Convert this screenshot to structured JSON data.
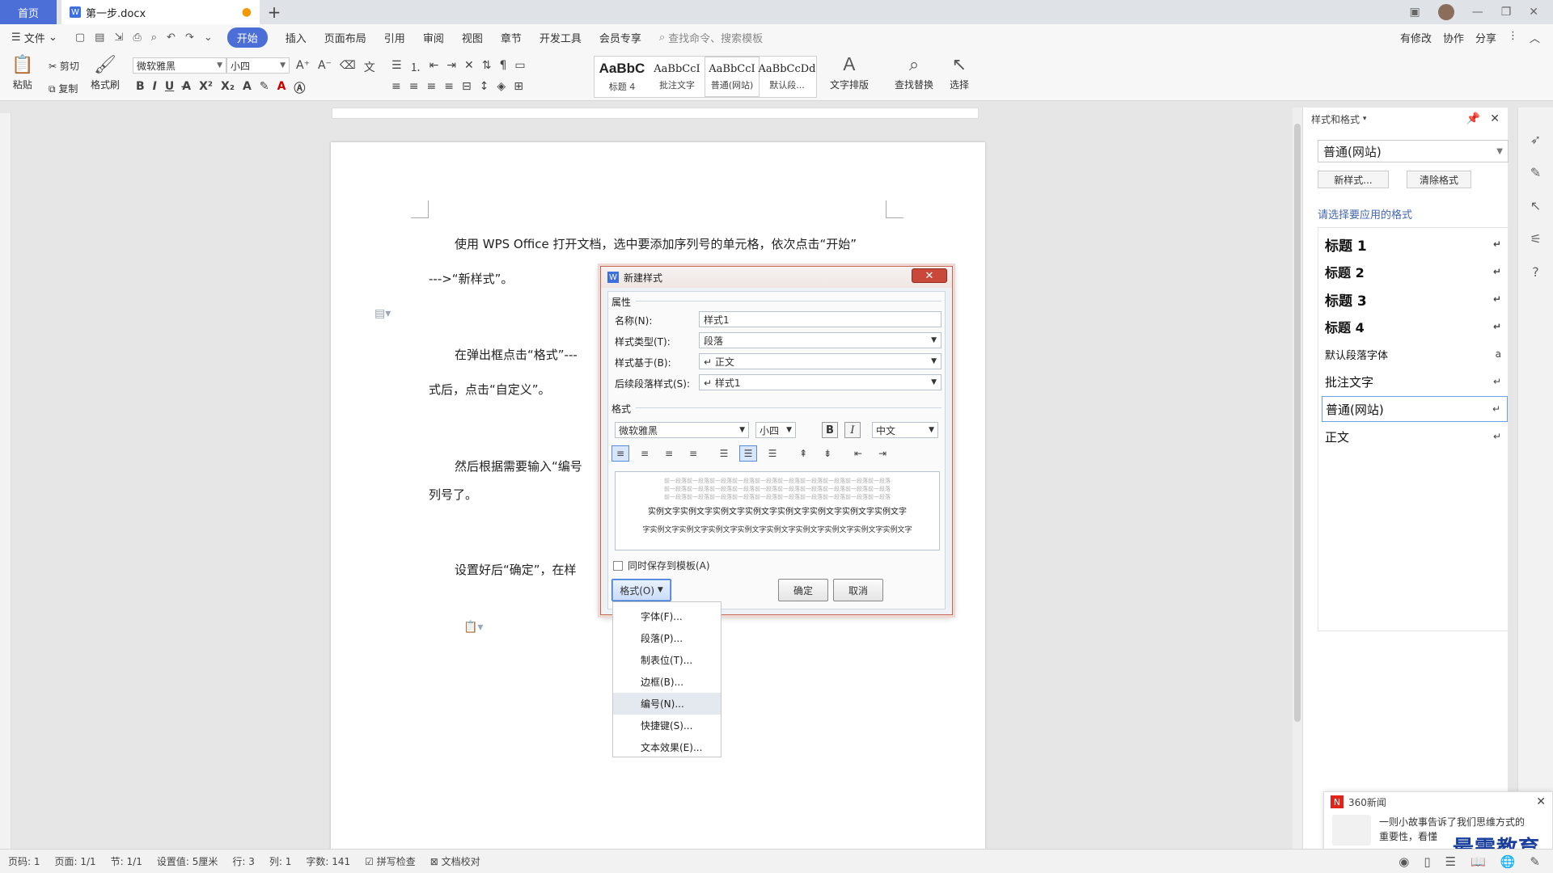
{
  "titlebar": {
    "home_tab": "首页",
    "doc_tab": "第一步.docx",
    "doc_icon": "W",
    "modified_dot": "●",
    "new_tab": "+"
  },
  "menubar": {
    "file": "文件",
    "items": [
      "开始",
      "插入",
      "页面布局",
      "引用",
      "审阅",
      "视图",
      "章节",
      "开发工具",
      "会员专享"
    ],
    "search": "查找命令、搜索模板",
    "right": [
      "有修改",
      "协作",
      "分享"
    ]
  },
  "ribbon": {
    "paste": "粘贴",
    "cut": "剪切",
    "copy": "复制",
    "format_painter": "格式刷",
    "font_name": "微软雅黑",
    "font_size": "小四",
    "styles": [
      {
        "sample": "AaBbC",
        "label": "标题 4"
      },
      {
        "sample": "AaBbCcI",
        "label": "批注文字"
      },
      {
        "sample": "AaBbCcI",
        "label": "普通(网站)"
      },
      {
        "sample": "AaBbCcDd",
        "label": "默认段..."
      }
    ],
    "text_layout": "文字排版",
    "find_replace": "查找替换",
    "select": "选择"
  },
  "document": {
    "p1": "使用 WPS Office 打开文档，选中要添加序列号的单元格，依次点击“开始”",
    "p2": "--->“新样式”。",
    "p3": "在弹出框点击“格式”---",
    "p4": "式后，点击“自定义”。",
    "p5": "然后根据需要输入“编号",
    "p6": "列号了。",
    "p7": "设置好后“确定”，在样"
  },
  "dialog": {
    "title": "新建样式",
    "section_props": "属性",
    "name_label": "名称(N):",
    "name_value": "样式1",
    "type_label": "样式类型(T):",
    "type_value": "段落",
    "based_label": "样式基于(B):",
    "based_value": "↵ 正文",
    "next_label": "后续段落样式(S):",
    "next_value": "↵ 样式1",
    "section_format": "格式",
    "font": "微软雅黑",
    "size": "小四",
    "bold": "B",
    "italic": "I",
    "lang": "中文",
    "preview_prev": "前一段落前一段落前一段落前一段落前一段落前一段落前一段落前一段落前一段落前一段落",
    "preview_sample": "实例文字实例文字实例文字实例文字实例文字实例文字实例文字实例文字",
    "preview_next": "字实例文字实例文字实例文字实例文字实例文字实例文字实例文字实例文字实例文字",
    "save_template": "同时保存到模板(A)",
    "format_btn": "格式(O)",
    "ok": "确定",
    "cancel": "取消"
  },
  "ctxmenu": [
    "字体(F)...",
    "段落(P)...",
    "制表位(T)...",
    "边框(B)...",
    "编号(N)...",
    "快捷键(S)...",
    "文本效果(E)..."
  ],
  "sidepanel": {
    "title": "样式和格式",
    "current": "普通(网站)",
    "new_style": "新样式...",
    "clear_format": "清除格式",
    "prompt": "请选择要应用的格式",
    "items": [
      {
        "label": "标题  1",
        "mark": "↵"
      },
      {
        "label": "标题  2",
        "mark": "↵"
      },
      {
        "label": "标题  3",
        "mark": "↵"
      },
      {
        "label": "标题  4",
        "mark": "↵"
      },
      {
        "label": "默认段落字体",
        "mark": "a"
      },
      {
        "label": "批注文字",
        "mark": "↵"
      },
      {
        "label": "普通(网站)",
        "mark": "↵"
      },
      {
        "label": "正文",
        "mark": "↵"
      }
    ]
  },
  "news": {
    "source": "360新闻",
    "text1": "一则小故事告诉了我们思维方式的",
    "text2": "重要性，看懂",
    "watermark": "最需教育"
  },
  "statusbar": [
    "页码: 1",
    "页面: 1/1",
    "节: 1/1",
    "设置值: 5厘米",
    "行: 3",
    "列: 1",
    "字数: 141",
    "拼写检查",
    "文档校对"
  ]
}
